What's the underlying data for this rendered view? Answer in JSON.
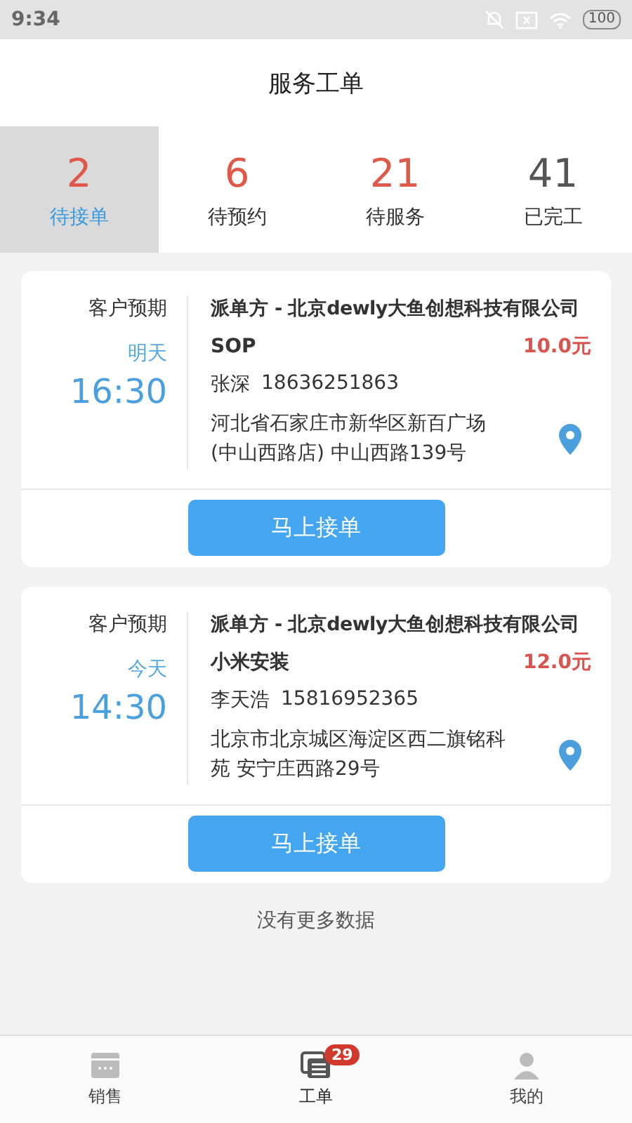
{
  "status_bar": {
    "time": "9:34",
    "battery": "100"
  },
  "header": {
    "title": "服务工单"
  },
  "tabs": [
    {
      "count": "2",
      "label": "待接单",
      "selected": true,
      "color": "#e0584a"
    },
    {
      "count": "6",
      "label": "待预约",
      "selected": false,
      "color": "#e0584a"
    },
    {
      "count": "21",
      "label": "待服务",
      "selected": false,
      "color": "#e0584a"
    },
    {
      "count": "41",
      "label": "已完工",
      "selected": false,
      "color": "#555555"
    }
  ],
  "orders": [
    {
      "expect_label": "客户预期",
      "day": "明天",
      "time": "16:30",
      "dispatcher": "派单方 - 北京dewly大鱼创想科技有限公司",
      "service": "SOP",
      "price": "10.0元",
      "contact": "张深",
      "phone": "18636251863",
      "address": "河北省石家庄市新华区新百广场(中山西路店) 中山西路139号",
      "action": "马上接单"
    },
    {
      "expect_label": "客户预期",
      "day": "今天",
      "time": "14:30",
      "dispatcher": "派单方 - 北京dewly大鱼创想科技有限公司",
      "service": "小米安装",
      "price": "12.0元",
      "contact": "李天浩",
      "phone": "15816952365",
      "address": "北京市北京城区海淀区西二旗铭科苑 安宁庄西路29号",
      "action": "马上接单"
    }
  ],
  "footer_note": "没有更多数据",
  "nav": [
    {
      "kind": "sales",
      "label": "销售",
      "selected": false
    },
    {
      "kind": "orders",
      "label": "工单",
      "badge": "29",
      "selected": true
    },
    {
      "kind": "me",
      "label": "我的",
      "selected": false
    }
  ]
}
